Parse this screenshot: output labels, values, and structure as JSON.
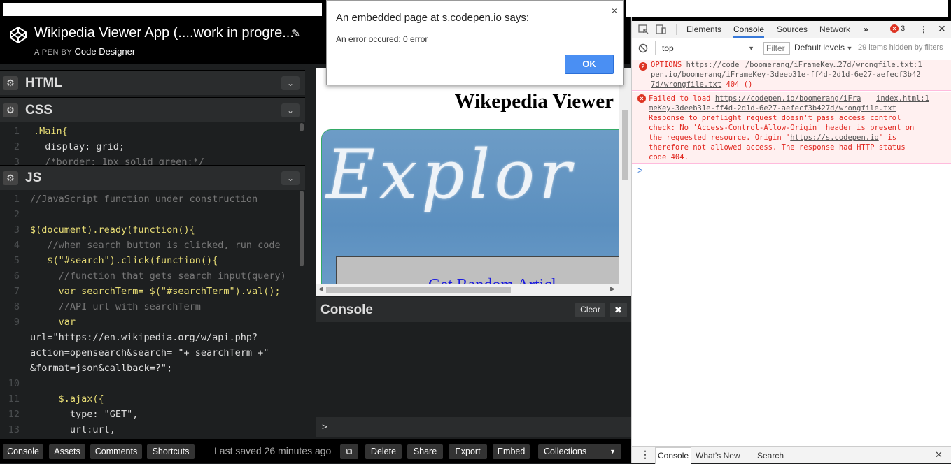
{
  "header": {
    "title": "Wikipedia Viewer App (....work in progre...",
    "by_prefix": "A PEN BY",
    "author": "Code Designer"
  },
  "editors": {
    "html_label": "HTML",
    "css_label": "CSS",
    "js_label": "JS",
    "css_lines": [
      {
        "n": "1",
        "text": ".Main{"
      },
      {
        "n": "2",
        "text": "  display: grid;"
      },
      {
        "n": "3",
        "text": "  /*border: 1px solid green;*/"
      }
    ],
    "js_lines": [
      {
        "n": "1",
        "text": "//JavaScript function under construction"
      },
      {
        "n": "2",
        "text": ""
      },
      {
        "n": "3",
        "text": "$(document).ready(function(){"
      },
      {
        "n": "4",
        "text": "   //when search button is clicked, run code"
      },
      {
        "n": "5",
        "text": "   $(\"#search\").click(function(){"
      },
      {
        "n": "6",
        "text": "     //function that gets search input(query)"
      },
      {
        "n": "7",
        "text": "     var searchTerm= $(\"#searchTerm\").val();"
      },
      {
        "n": "8",
        "text": "     //API url with searchTerm"
      },
      {
        "n": "9",
        "text": "     var"
      },
      {
        "n": "",
        "text": "url=\"https://en.wikipedia.org/w/api.php?"
      },
      {
        "n": "",
        "text": "action=opensearch&search= \"+ searchTerm +\""
      },
      {
        "n": "",
        "text": "&format=json&callback=?\";"
      },
      {
        "n": "10",
        "text": ""
      },
      {
        "n": "11",
        "text": "     $.ajax({"
      },
      {
        "n": "12",
        "text": "       type: \"GET\","
      },
      {
        "n": "13",
        "text": "       url:url,"
      }
    ]
  },
  "preview": {
    "heading": "Wikepedia Viewer",
    "hero_text": "Explor",
    "random_link": "Get Random Articl"
  },
  "console_panel": {
    "title": "Console",
    "clear_label": "Clear",
    "close_glyph": "✖",
    "prompt": ">"
  },
  "bottombar": {
    "console": "Console",
    "assets": "Assets",
    "comments": "Comments",
    "shortcuts": "Shortcuts",
    "last_saved": "Last saved 26 minutes ago",
    "delete": "Delete",
    "share": "Share",
    "export": "Export",
    "embed": "Embed",
    "collections": "Collections"
  },
  "dialog": {
    "title": "An embedded page at s.codepen.io says:",
    "message": "An error occured: 0 error",
    "ok": "OK",
    "close": "×"
  },
  "devtools": {
    "tabs": [
      "Elements",
      "Console",
      "Sources",
      "Network"
    ],
    "active_tab": "Console",
    "error_count": "3",
    "context": "top",
    "filter_placeholder": "Filter",
    "levels": "Default levels",
    "hidden": "29 items hidden by filters",
    "msg1": {
      "count": "2",
      "method": "OPTIONS",
      "url1": "https://code",
      "source": "/boomerang/iFrameKey…27d/wrongfile.txt:1",
      "url2": "pen.io/boomerang/iFrameKey-3deeb31e-ff4d-2d1d-6e27-aefecf3b42",
      "url3": "7d/wrongfile.txt",
      "status": "404 ()"
    },
    "msg2": {
      "prefix": "Failed to load",
      "url": "https://codepen.io/boomerang/iFra",
      "source": "index.html:1",
      "line2": "meKey-3deeb31e-ff4d-2d1d-6e27-aefecf3b427d/wrongfile.txt",
      "line3": "Response to preflight request doesn't pass access control",
      "line4": "check: No 'Access-Control-Allow-Origin' header is present on",
      "line5": "the requested resource. Origin '",
      "origin": "https://s.codepen.io",
      "line5b": "' is",
      "line6": "therefore not allowed access. The response had HTTP status",
      "line7": "code 404."
    },
    "prompt": ">",
    "bottom_tabs": [
      "Console",
      "What's New",
      "Search"
    ]
  },
  "colors": {
    "accent_blue": "#4a8ff3",
    "error_red": "#e0261e",
    "editor_bg": "#1d1f20"
  }
}
